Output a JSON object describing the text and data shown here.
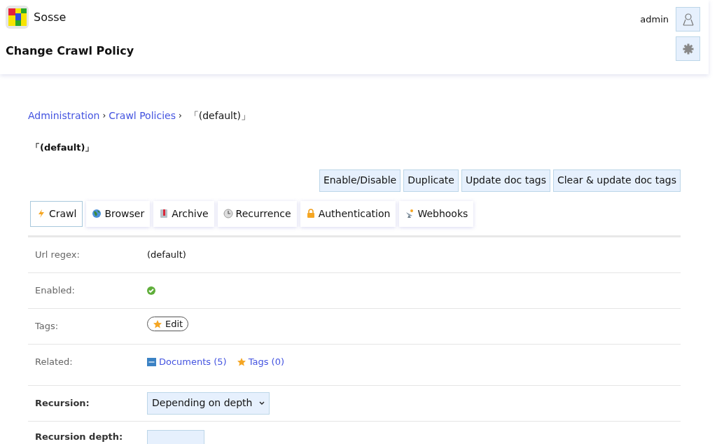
{
  "app": {
    "name": "Sosse",
    "page_title": "Change Crawl Policy",
    "user": "admin"
  },
  "breadcrumb": {
    "links": [
      "Administration",
      "Crawl Policies"
    ],
    "separator": "›",
    "current": "「(default)」"
  },
  "heading": "「(default)」",
  "actions": [
    "Enable/Disable",
    "Duplicate",
    "Update doc tags",
    "Clear & update doc tags"
  ],
  "tabs": [
    {
      "label": "Crawl",
      "selected": true
    },
    {
      "label": "Browser",
      "selected": false
    },
    {
      "label": "Archive",
      "selected": false
    },
    {
      "label": "Recurrence",
      "selected": false
    },
    {
      "label": "Authentication",
      "selected": false
    },
    {
      "label": "Webhooks",
      "selected": false
    }
  ],
  "fields": [
    {
      "kind": "text",
      "label": "Url regex:",
      "value": "(default)"
    },
    {
      "kind": "check",
      "label": "Enabled:",
      "checked": true
    },
    {
      "kind": "button",
      "label": "Tags:",
      "value": "Edit"
    },
    {
      "kind": "links",
      "label": "Related:",
      "links": [
        "Documents (5)",
        "Tags (0)"
      ]
    },
    {
      "kind": "select",
      "label": "Recursion:",
      "value": "Depending on depth"
    },
    {
      "kind": "number",
      "label": "Recursion depth:"
    }
  ]
}
